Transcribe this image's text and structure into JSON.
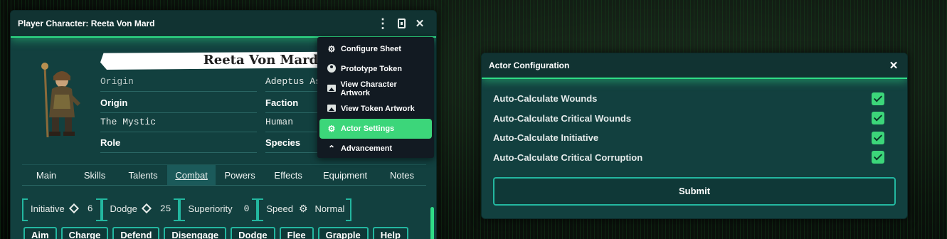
{
  "sheet": {
    "title": "Player Character: Reeta Von Mard",
    "character_name": "Reeta Von Mard",
    "menu_icon": "vertical-dots-icon",
    "journal_icon": "journal-icon",
    "close_icon": "close-icon",
    "close_glyph": "✕",
    "dots_glyph": "⋮",
    "fields": {
      "origin_value": "Origin",
      "origin_label": "Origin",
      "origin_detail": "The Mystic",
      "role_label": "Role",
      "faction_value": "Adeptus As",
      "faction_label": "Faction",
      "species_value": "Human",
      "species_label": "Species"
    },
    "tabs": [
      "Main",
      "Skills",
      "Talents",
      "Combat",
      "Powers",
      "Effects",
      "Equipment",
      "Notes"
    ],
    "active_tab": "Combat",
    "stats": [
      {
        "label": "Initiative",
        "icon": "d20-icon",
        "value": "6"
      },
      {
        "label": "Dodge",
        "icon": "d20-icon",
        "value": "25"
      },
      {
        "label": "Superiority",
        "value": "0"
      },
      {
        "label": "Speed",
        "icon": "gear-icon",
        "value": "Normal"
      }
    ],
    "actions": [
      "Aim",
      "Charge",
      "Defend",
      "Disengage",
      "Dodge",
      "Flee",
      "Grapple",
      "Help"
    ]
  },
  "context_menu": {
    "items": [
      {
        "label": "Configure Sheet",
        "icon": "gear-icon"
      },
      {
        "label": "Prototype Token",
        "icon": "user-circle-icon"
      },
      {
        "label": "View Character Artwork",
        "icon": "image-icon"
      },
      {
        "label": "View Token Artwork",
        "icon": "image-icon"
      },
      {
        "label": "Actor Settings",
        "icon": "gear-icon"
      },
      {
        "label": "Advancement",
        "icon": "chevron-up-icon"
      }
    ],
    "active_item": "Actor Settings"
  },
  "actor_config": {
    "title": "Actor Configuration",
    "options": [
      {
        "label": "Auto-Calculate Wounds",
        "checked": true
      },
      {
        "label": "Auto-Calculate Critical Wounds",
        "checked": true
      },
      {
        "label": "Auto-Calculate Initiative",
        "checked": true
      },
      {
        "label": "Auto-Calculate Critical Corruption",
        "checked": true
      }
    ],
    "submit_label": "Submit"
  },
  "colors": {
    "accent": "#3cd67a",
    "panel": "#12403f",
    "header": "#113332",
    "border": "#23b7a0"
  }
}
